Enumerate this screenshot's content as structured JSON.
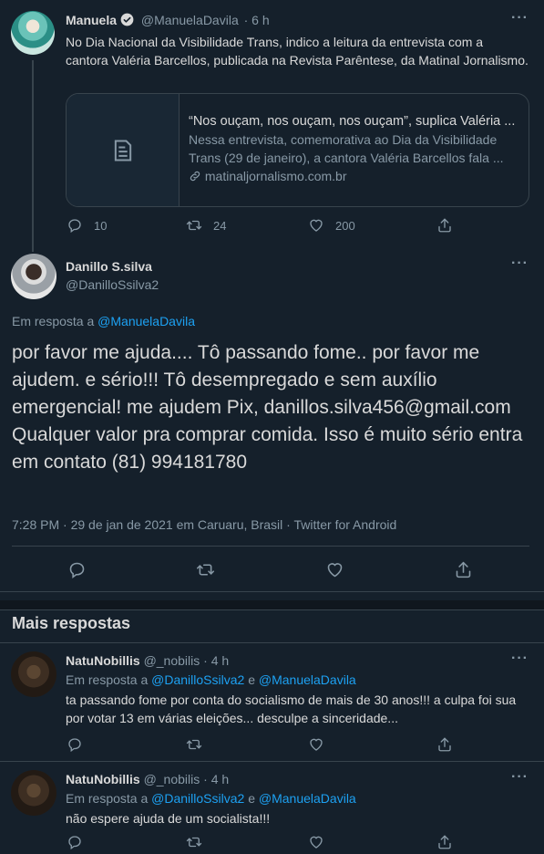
{
  "tweet1": {
    "name": "Manuela",
    "handle": "@ManuelaDavila",
    "time": "· 6 h",
    "text": "No Dia Nacional da Visibilidade Trans, indico a leitura da entrevista com a cantora Valéria Barcellos, publicada na Revista Parêntese, da Matinal Jornalismo.",
    "card": {
      "title": "“Nos ouçam, nos ouçam, nos ouçam”, suplica Valéria ...",
      "description": "Nessa entrevista, comemorativa ao Dia da Visibilidade Trans (29 de janeiro), a cantora Valéria Barcellos fala ...",
      "link": "matinaljornalismo.com.br"
    },
    "replies": "10",
    "retweets": "24",
    "likes": "200"
  },
  "main_tweet": {
    "name": "Danillo S.silva",
    "handle": "@DanilloSsilva2",
    "reply_prefix": "Em resposta a",
    "reply_to": "@ManuelaDavila",
    "text": "por favor me ajuda.... Tô passando fome.. por favor me ajudem. e sério!!! Tô desempregado e sem auxílio emergencial! me ajudem Pix, danillos.silva456@gmail.com\nQualquer valor pra comprar comida. Isso é muito sério entra  em contato (81) 994181780",
    "meta": "7:28 PM · 29 de jan de 2021 em Caruaru, Brasil · Twitter for Android"
  },
  "more_replies_title": "Mais respostas",
  "reply1": {
    "name": "NatuNobillis",
    "handle": "@_nobilis",
    "time": "· 4 h",
    "reply_prefix": "Em resposta a",
    "mention1": "@DanilloSsilva2",
    "conj": "e",
    "mention2": "@ManuelaDavila",
    "text": "ta passando fome por conta do socialismo de mais de 30 anos!!! a culpa foi sua por votar 13 em várias eleições... desculpe a sinceridade..."
  },
  "reply2": {
    "name": "NatuNobillis",
    "handle": "@_nobilis",
    "time": "· 4 h",
    "reply_prefix": "Em resposta a",
    "mention1": "@DanilloSsilva2",
    "conj": "e",
    "mention2": "@ManuelaDavila",
    "text": "não espere ajuda de um socialista!!!"
  },
  "more_glyph": "···",
  "icons": {
    "reply": "reply-icon",
    "retweet": "retweet-icon",
    "like": "heart-icon",
    "share": "share-icon",
    "link": "link-icon",
    "article": "article-icon",
    "verified": "verified-badge-icon"
  },
  "colors": {
    "background": "#15202b",
    "text": "#d9d9d9",
    "secondary": "#8899a6",
    "accent": "#1da1f2",
    "border": "#38444d"
  }
}
